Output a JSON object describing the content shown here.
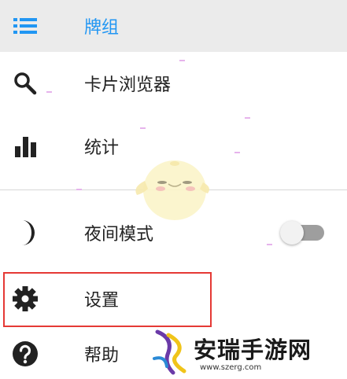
{
  "menu": {
    "decks_label": "牌组",
    "browser_label": "卡片浏览器",
    "stats_label": "统计",
    "night_mode_label": "夜间模式",
    "night_mode_on": false,
    "settings_label": "设置",
    "help_label": "帮助"
  },
  "watermark": {
    "title": "安瑞手游网",
    "url": "www.szerg.com"
  },
  "colors": {
    "accent": "#2196f3",
    "highlight_border": "#e53935"
  },
  "icons": {
    "decks": "list-icon",
    "browser": "search-icon",
    "stats": "bar-chart-icon",
    "night": "moon-icon",
    "settings": "gear-icon",
    "help": "help-icon"
  }
}
